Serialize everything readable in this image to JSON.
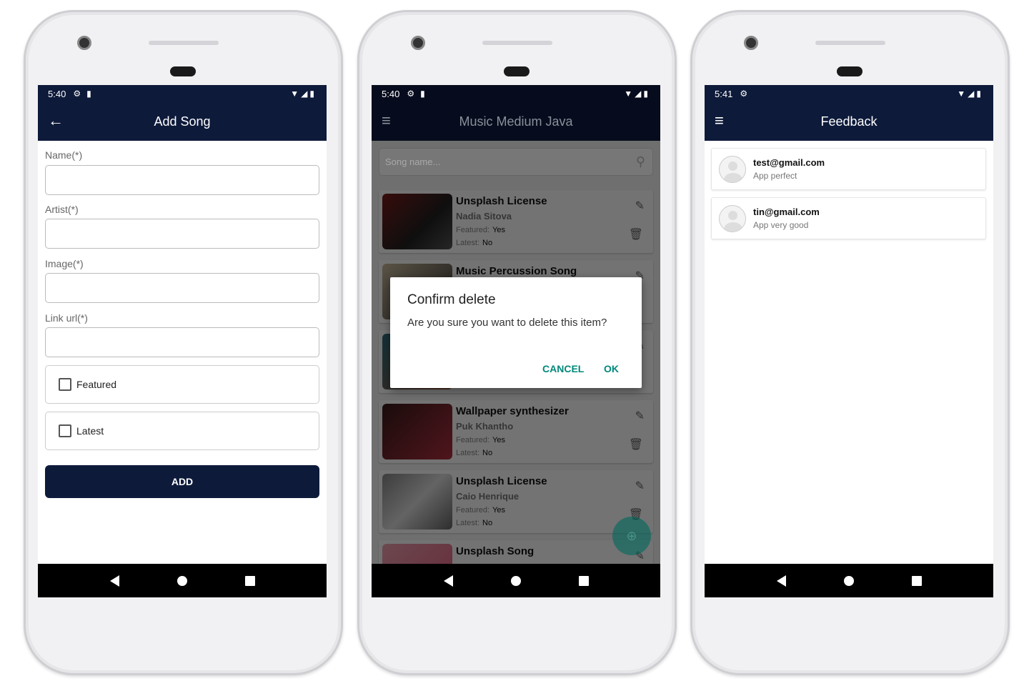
{
  "add_song": {
    "status": {
      "time": "5:40"
    },
    "title": "Add Song",
    "fields": [
      {
        "label": "Name(*)",
        "value": ""
      },
      {
        "label": "Artist(*)",
        "value": ""
      },
      {
        "label": "Image(*)",
        "value": ""
      },
      {
        "label": "Link url(*)",
        "value": ""
      }
    ],
    "checkboxes": [
      {
        "label": "Featured",
        "checked": false
      },
      {
        "label": "Latest",
        "checked": false
      }
    ],
    "add_label": "ADD"
  },
  "song_list": {
    "status": {
      "time": "5:40"
    },
    "title": "Music Medium Java",
    "search_placeholder": "Song name...",
    "featured_label": "Featured:",
    "latest_label": "Latest:",
    "songs": [
      {
        "title": "Unsplash License",
        "artist": "Nadia Sitova",
        "featured": "Yes",
        "latest": "No"
      },
      {
        "title": "Music Percussion Song",
        "artist": "",
        "featured": "",
        "latest": ""
      },
      {
        "title": "",
        "artist": "",
        "featured": "",
        "latest": ""
      },
      {
        "title": "Wallpaper synthesizer",
        "artist": "Puk Khantho",
        "featured": "Yes",
        "latest": "No"
      },
      {
        "title": "Unsplash License",
        "artist": "Caio Henrique",
        "featured": "Yes",
        "latest": "No"
      },
      {
        "title": "Unsplash Song",
        "artist": "",
        "featured": "",
        "latest": ""
      }
    ],
    "dialog": {
      "title": "Confirm delete",
      "message": "Are you sure you want to delete this item?",
      "cancel": "CANCEL",
      "ok": "OK"
    }
  },
  "feedback": {
    "status": {
      "time": "5:41"
    },
    "title": "Feedback",
    "items": [
      {
        "email": "test@gmail.com",
        "message": "App perfect"
      },
      {
        "email": "tin@gmail.com",
        "message": "App very good"
      }
    ]
  },
  "colors": {
    "primary": "#0d1a3a",
    "accent": "#00897b"
  }
}
